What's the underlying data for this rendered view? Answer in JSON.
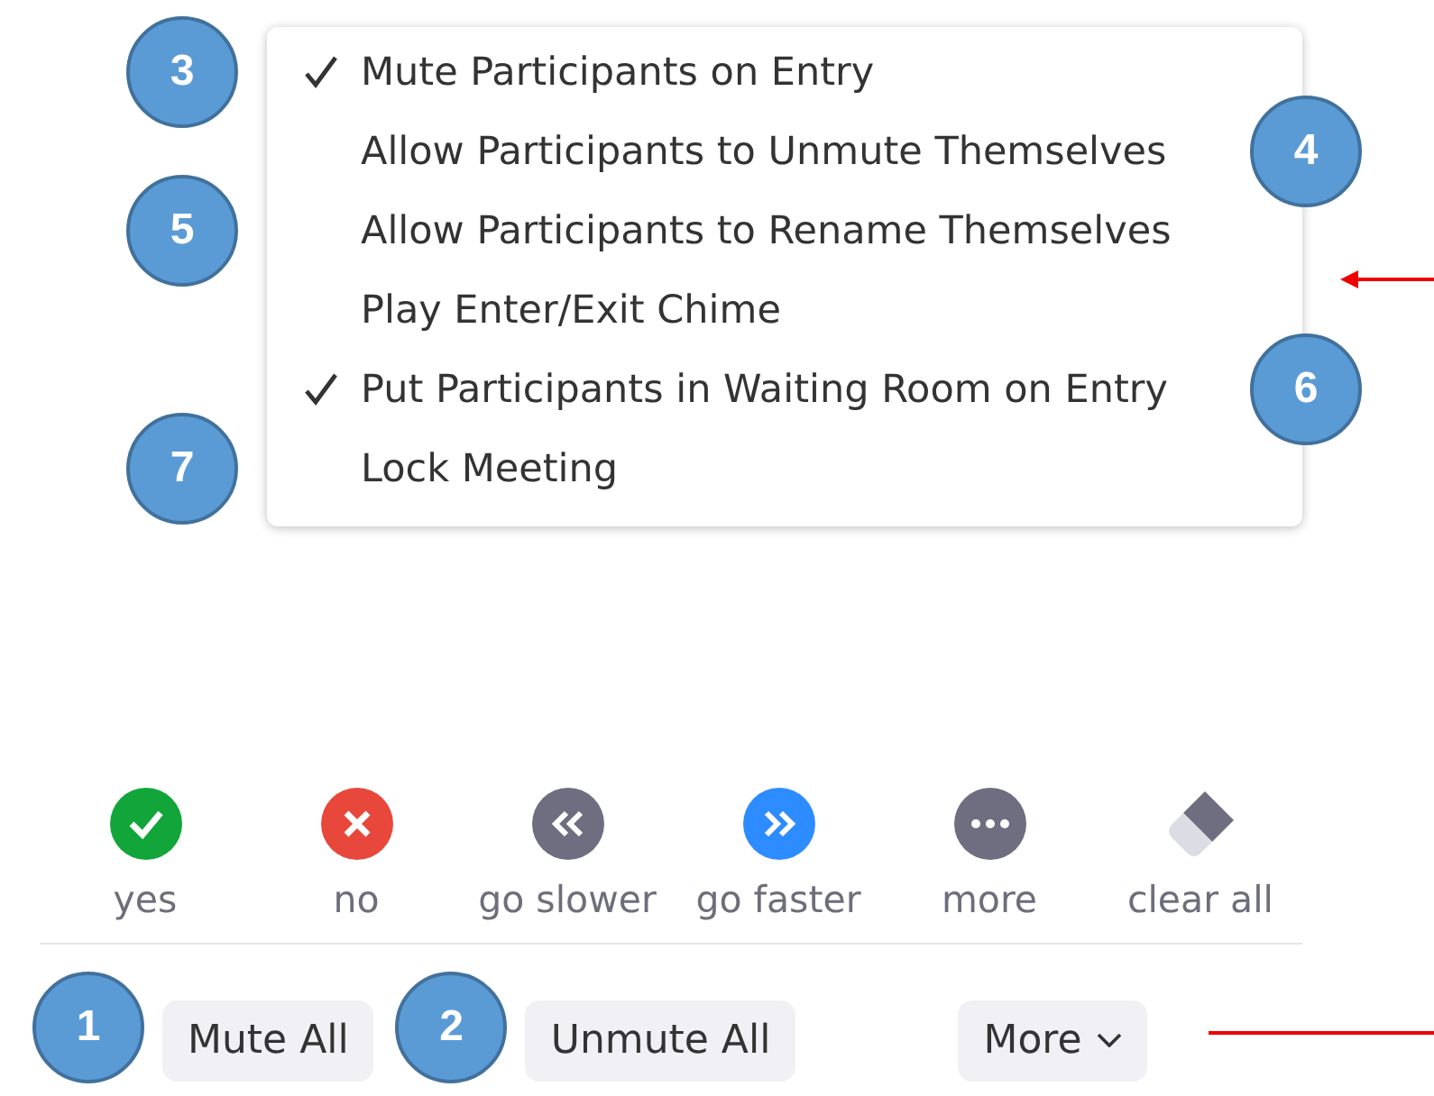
{
  "menu": {
    "items": [
      {
        "label": "Mute Participants on Entry",
        "checked": true,
        "callout": {
          "number": "3",
          "kind": "left"
        }
      },
      {
        "label": "Allow Participants to Unmute Themselves",
        "checked": false,
        "callout": {
          "number": "4",
          "kind": "right"
        }
      },
      {
        "label": "Allow Participants to Rename Themselves",
        "checked": false,
        "callout": {
          "number": "5",
          "kind": "left"
        }
      },
      {
        "label": "Play Enter/Exit Chime",
        "checked": false
      },
      {
        "label": "Put Participants in Waiting Room on Entry",
        "checked": true,
        "callout": {
          "number": "6",
          "kind": "right"
        }
      },
      {
        "label": "Lock Meeting",
        "checked": false,
        "callout": {
          "number": "7",
          "kind": "left"
        }
      }
    ]
  },
  "reactions": [
    {
      "label": "yes",
      "kind": "check",
      "color": "#12a53a"
    },
    {
      "label": "no",
      "kind": "cross",
      "color": "#e8473b"
    },
    {
      "label": "go slower",
      "kind": "rewind",
      "color": "#6e6e80"
    },
    {
      "label": "go faster",
      "kind": "forward",
      "color": "#2d8cff"
    },
    {
      "label": "more",
      "kind": "dots",
      "color": "#6e6e80"
    },
    {
      "label": "clear all",
      "kind": "eraser"
    }
  ],
  "buttons": [
    {
      "label": "Mute All",
      "callout": "1",
      "kind": "plain"
    },
    {
      "label": "Unmute All",
      "callout": "2",
      "kind": "plain"
    },
    {
      "label": "More",
      "kind": "dropdown"
    }
  ]
}
